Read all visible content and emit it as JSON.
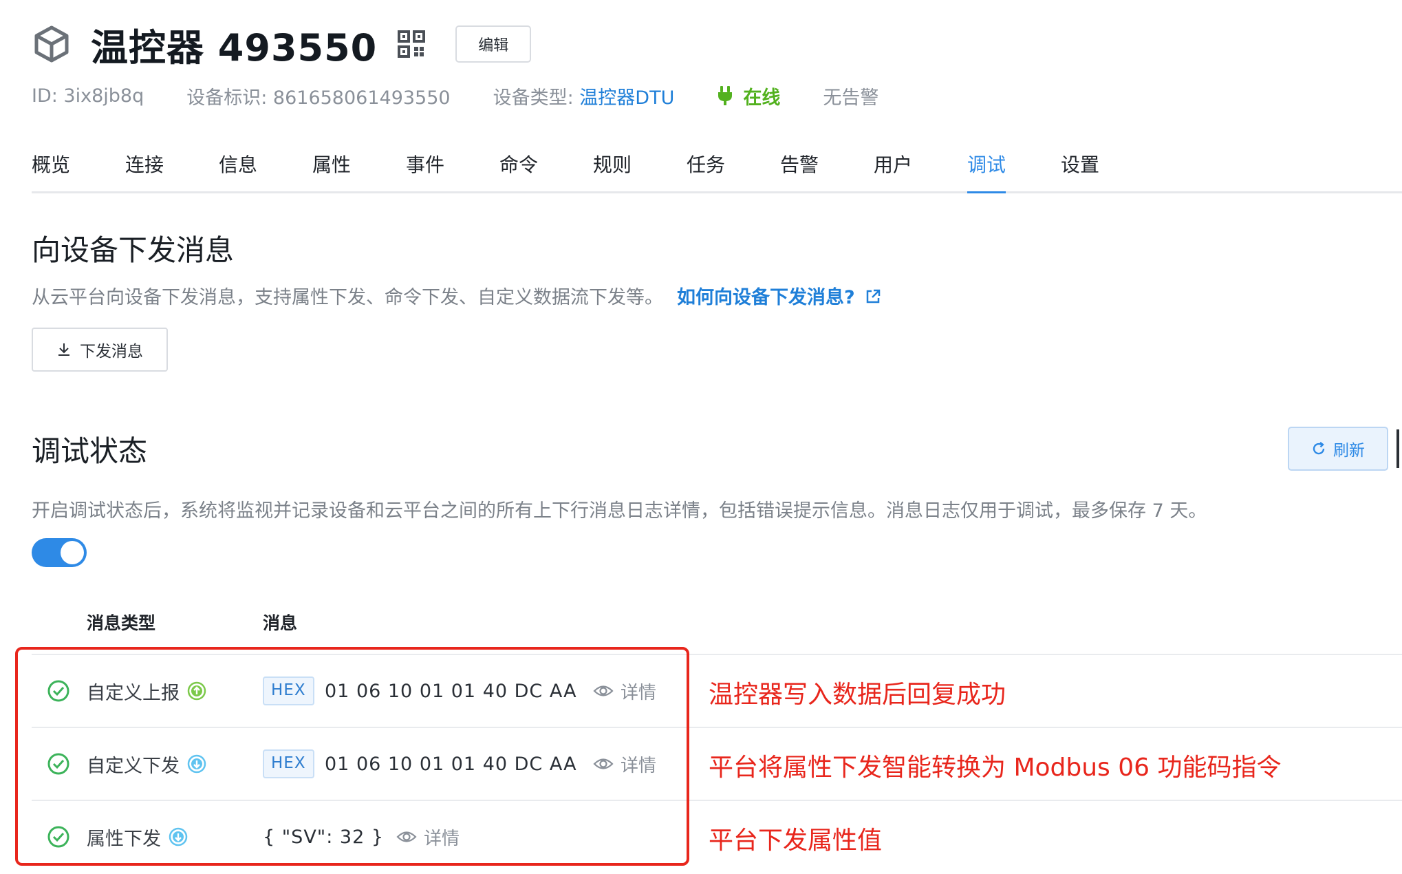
{
  "header": {
    "title": "温控器 493550",
    "edit_label": "编辑",
    "id_text": "ID: 3ix8jb8q",
    "device_key_text": "设备标识: 861658061493550",
    "device_type_label": "设备类型:",
    "device_type_value": "温控器DTU",
    "status": "在线",
    "alarm": "无告警"
  },
  "tabs": [
    {
      "label": "概览"
    },
    {
      "label": "连接"
    },
    {
      "label": "信息"
    },
    {
      "label": "属性"
    },
    {
      "label": "事件"
    },
    {
      "label": "命令"
    },
    {
      "label": "规则"
    },
    {
      "label": "任务"
    },
    {
      "label": "告警"
    },
    {
      "label": "用户"
    },
    {
      "label": "调试",
      "active": true
    },
    {
      "label": "设置"
    }
  ],
  "send_section": {
    "title": "向设备下发消息",
    "desc": "从云平台向设备下发消息，支持属性下发、命令下发、自定义数据流下发等。",
    "help_link": "如何向设备下发消息?",
    "button": "下发消息"
  },
  "debug_section": {
    "title": "调试状态",
    "refresh": "刷新",
    "desc": "开启调试状态后，系统将监视并记录设备和云平台之间的所有上下行消息日志详情，包括错误提示信息。消息日志仅用于调试，最多保存 7 天。",
    "enabled": true
  },
  "table": {
    "col_type": "消息类型",
    "col_message": "消息",
    "rows": [
      {
        "type": "自定义上报",
        "direction": "up",
        "tag": "HEX",
        "message": "01 06 10 01 01 40 DC AA",
        "detail": "详情"
      },
      {
        "type": "自定义下发",
        "direction": "down",
        "tag": "HEX",
        "message": "01 06 10 01 01 40 DC AA",
        "detail": "详情"
      },
      {
        "type": "属性下发",
        "direction": "down",
        "tag": "",
        "message": "{ \"SV\": 32 }",
        "detail": "详情"
      }
    ]
  },
  "annotations": [
    "温控器写入数据后回复成功",
    "平台将属性下发智能转换为 Modbus 06 功能码指令",
    "平台下发属性值"
  ],
  "colors": {
    "accent": "#2e8ae6",
    "online": "#52b11e",
    "success": "#3cb35a",
    "annotation": "#e8261c"
  }
}
